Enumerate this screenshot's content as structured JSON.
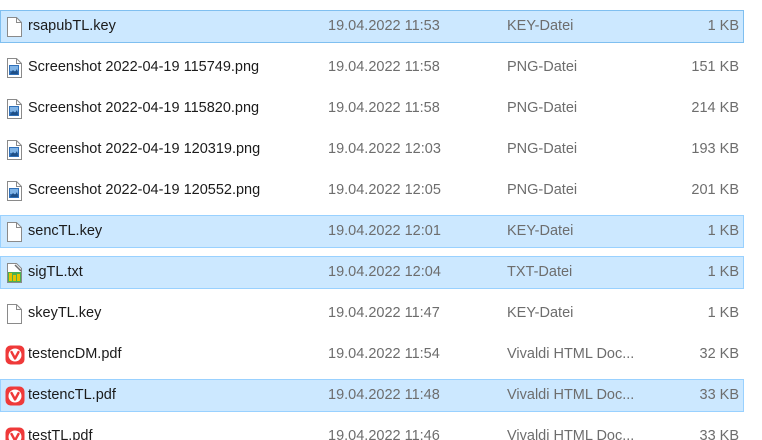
{
  "files": [
    {
      "name": "rsapubTL.key",
      "date": "19.04.2022 11:53",
      "type": "KEY-Datei",
      "size": "1 KB",
      "icon": "blank-file-icon",
      "selected": true
    },
    {
      "name": "Screenshot 2022-04-19 115749.png",
      "date": "19.04.2022 11:58",
      "type": "PNG-Datei",
      "size": "151 KB",
      "icon": "png-image-icon",
      "selected": false
    },
    {
      "name": "Screenshot 2022-04-19 115820.png",
      "date": "19.04.2022 11:58",
      "type": "PNG-Datei",
      "size": "214 KB",
      "icon": "png-image-icon",
      "selected": false
    },
    {
      "name": "Screenshot 2022-04-19 120319.png",
      "date": "19.04.2022 12:03",
      "type": "PNG-Datei",
      "size": "193 KB",
      "icon": "png-image-icon",
      "selected": false
    },
    {
      "name": "Screenshot 2022-04-19 120552.png",
      "date": "19.04.2022 12:05",
      "type": "PNG-Datei",
      "size": "201 KB",
      "icon": "png-image-icon",
      "selected": false
    },
    {
      "name": "sencTL.key",
      "date": "19.04.2022 12:01",
      "type": "KEY-Datei",
      "size": "1 KB",
      "icon": "blank-file-icon",
      "selected": true
    },
    {
      "name": "sigTL.txt",
      "date": "19.04.2022 12:04",
      "type": "TXT-Datei",
      "size": "1 KB",
      "icon": "text-file-icon",
      "selected": true
    },
    {
      "name": "skeyTL.key",
      "date": "19.04.2022 11:47",
      "type": "KEY-Datei",
      "size": "1 KB",
      "icon": "blank-file-icon",
      "selected": false
    },
    {
      "name": "testencDM.pdf",
      "date": "19.04.2022 11:54",
      "type": "Vivaldi HTML Doc...",
      "size": "32 KB",
      "icon": "vivaldi-pdf-icon",
      "selected": false
    },
    {
      "name": "testencTL.pdf",
      "date": "19.04.2022 11:48",
      "type": "Vivaldi HTML Doc...",
      "size": "33 KB",
      "icon": "vivaldi-pdf-icon",
      "selected": true
    },
    {
      "name": "testTL.pdf",
      "date": "19.04.2022 11:46",
      "type": "Vivaldi HTML Doc...",
      "size": "33 KB",
      "icon": "vivaldi-pdf-icon",
      "selected": false
    }
  ],
  "colors": {
    "selection_bg": "#cce8ff",
    "selection_border": "#99d1ff",
    "vivaldi_red": "#ef3939",
    "secondary_text": "#6d6d6d"
  }
}
